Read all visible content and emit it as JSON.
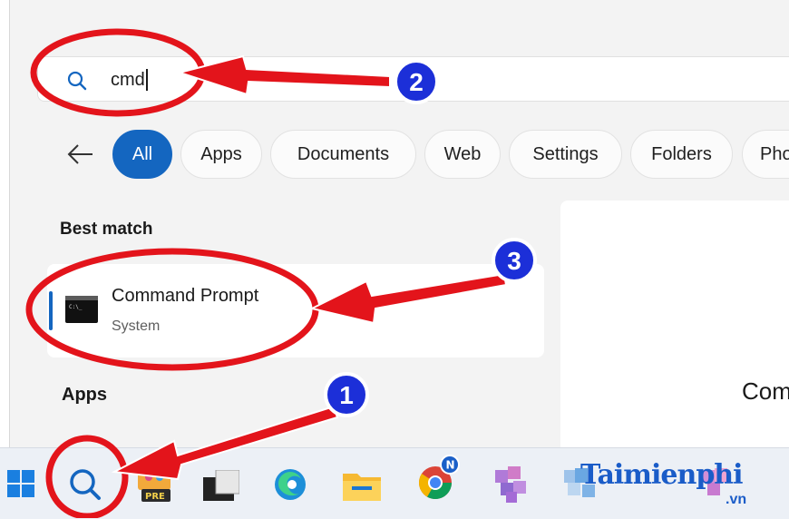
{
  "search": {
    "query": "cmd"
  },
  "filters": [
    "All",
    "Apps",
    "Documents",
    "Web",
    "Settings",
    "Folders",
    "Pho"
  ],
  "best_match": {
    "title": "Best match",
    "result": {
      "name": "Command Prompt",
      "subtitle": "System"
    }
  },
  "apps_section": {
    "title": "Apps"
  },
  "preview": {
    "title": "Com"
  },
  "taskbar": {
    "items": [
      "windows-start-icon",
      "search-icon",
      "paint-preview-icon",
      "terminal-icon",
      "edge-icon",
      "file-explorer-icon",
      "chrome-icon",
      "app-icon"
    ],
    "badge_n": "N",
    "badge_pre": "PRE"
  },
  "callouts": {
    "step1": "1",
    "step2": "2",
    "step3": "3"
  },
  "watermark": {
    "main": "Taimienphi",
    "sub": ".vn"
  },
  "colors": {
    "accent": "#1466c0",
    "annotation": "#e3141b",
    "callout": "#1c2fd8"
  }
}
